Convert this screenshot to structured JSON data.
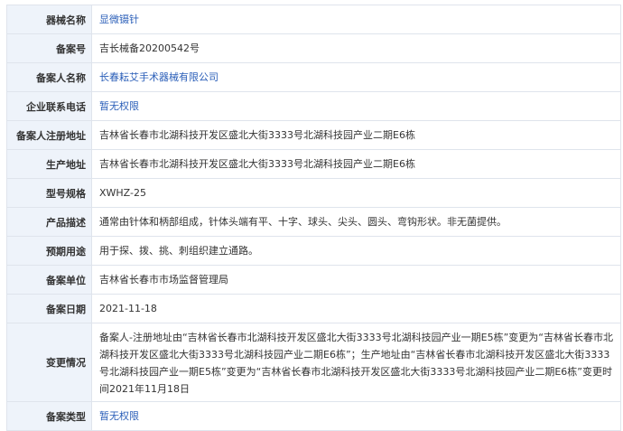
{
  "rows": [
    {
      "label": "器械名称",
      "value": "显微镊针",
      "link": true
    },
    {
      "label": "备案号",
      "value": "吉长械备20200542号",
      "link": false
    },
    {
      "label": "备案人名称",
      "value": "长春耘艾手术器械有限公司",
      "link": true
    },
    {
      "label": "企业联系电话",
      "value": "暂无权限",
      "link": true
    },
    {
      "label": "备案人注册地址",
      "value": "吉林省长春市北湖科技开发区盛北大街3333号北湖科技园产业二期E6栋",
      "link": false
    },
    {
      "label": "生产地址",
      "value": "吉林省长春市北湖科技开发区盛北大街3333号北湖科技园产业二期E6栋",
      "link": false
    },
    {
      "label": "型号规格",
      "value": "XWHZ-25",
      "link": false
    },
    {
      "label": "产品描述",
      "value": "通常由针体和柄部组成，针体头端有平、十字、球头、尖头、圆头、弯钩形状。非无菌提供。",
      "link": false
    },
    {
      "label": "预期用途",
      "value": "用于探、拨、挑、刺组织建立通路。",
      "link": false
    },
    {
      "label": "备案单位",
      "value": "吉林省长春市市场监督管理局",
      "link": false
    },
    {
      "label": "备案日期",
      "value": "2021-11-18",
      "link": false
    },
    {
      "label": "变更情况",
      "value": "备案人-注册地址由“吉林省长春市北湖科技开发区盛北大街3333号北湖科技园产业一期E5栋”变更为“吉林省长春市北湖科技开发区盛北大街3333号北湖科技园产业二期E6栋”；生产地址由“吉林省长春市北湖科技开发区盛北大街3333号北湖科技园产业一期E5栋”变更为“吉林省长春市北湖科技开发区盛北大街3333号北湖科技园产业二期E6栋”变更时间2021年11月18日",
      "link": false
    },
    {
      "label": "备案类型",
      "value": "暂无权限",
      "link": true
    }
  ]
}
